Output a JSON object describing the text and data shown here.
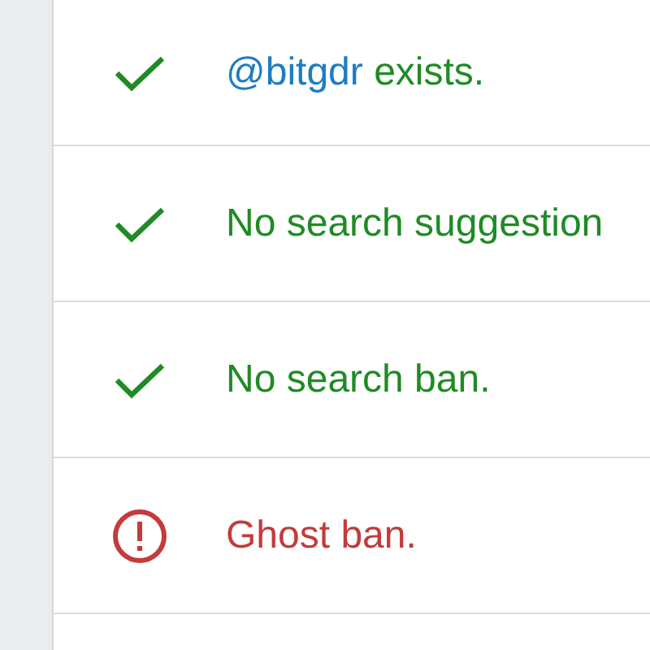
{
  "checks": [
    {
      "kind": "pass",
      "handle": "@bitgdr",
      "text": "exists."
    },
    {
      "kind": "pass",
      "text": "No search suggestion"
    },
    {
      "kind": "pass",
      "text": "No search ban."
    },
    {
      "kind": "fail",
      "text": "Ghost ban."
    }
  ]
}
